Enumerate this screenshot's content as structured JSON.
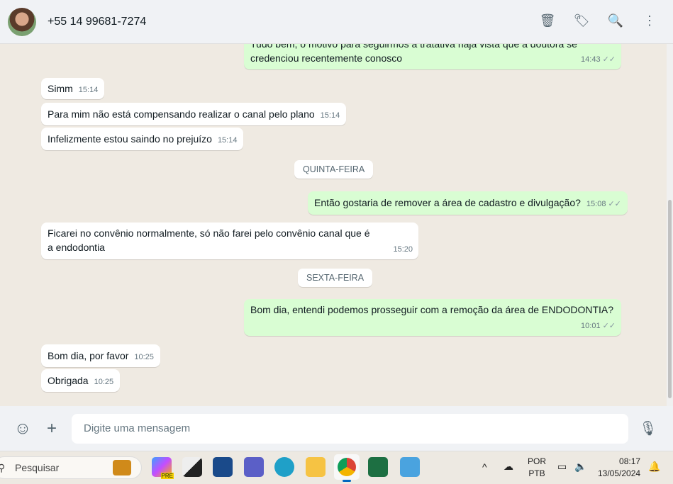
{
  "header": {
    "contact": "+55 14 99681-7274"
  },
  "messages": [
    {
      "dir": "out",
      "text_line1": "Tudo bem, o motivo para seguirmos a tratativa haja vista que a doutora se",
      "text_line2": "credenciou recentemente conosco",
      "time": "14:43"
    },
    {
      "dir": "in",
      "text": "Simm",
      "time": "15:14"
    },
    {
      "dir": "in",
      "text": "Para mim não está compensando realizar o canal pelo plano",
      "time": "15:14"
    },
    {
      "dir": "in",
      "text": "Infelizmente estou saindo no prejuízo",
      "time": "15:14"
    },
    {
      "dir": "out",
      "text": "Então gostaria de remover a área de cadastro e divulgação?",
      "time": "15:08"
    },
    {
      "dir": "in",
      "text": "Ficarei no convênio normalmente, só não farei pelo convênio canal que é a endodontia",
      "time": "15:20"
    },
    {
      "dir": "out",
      "text": "Bom dia, entendi podemos prosseguir com a remoção da área de ENDODONTIA?",
      "time": "10:01"
    },
    {
      "dir": "in",
      "text": "Bom dia, por favor",
      "time": "10:25"
    },
    {
      "dir": "in",
      "text": "Obrigada",
      "time": "10:25"
    }
  ],
  "days": [
    "QUINTA-FEIRA",
    "SEXTA-FEIRA"
  ],
  "composer": {
    "placeholder": "Digite uma mensagem"
  },
  "taskbar": {
    "search": "Pesquisar",
    "lang1": "POR",
    "lang2": "PTB",
    "clock": "08:17",
    "date": "13/05/2024",
    "copilot_badge": "PRE"
  }
}
